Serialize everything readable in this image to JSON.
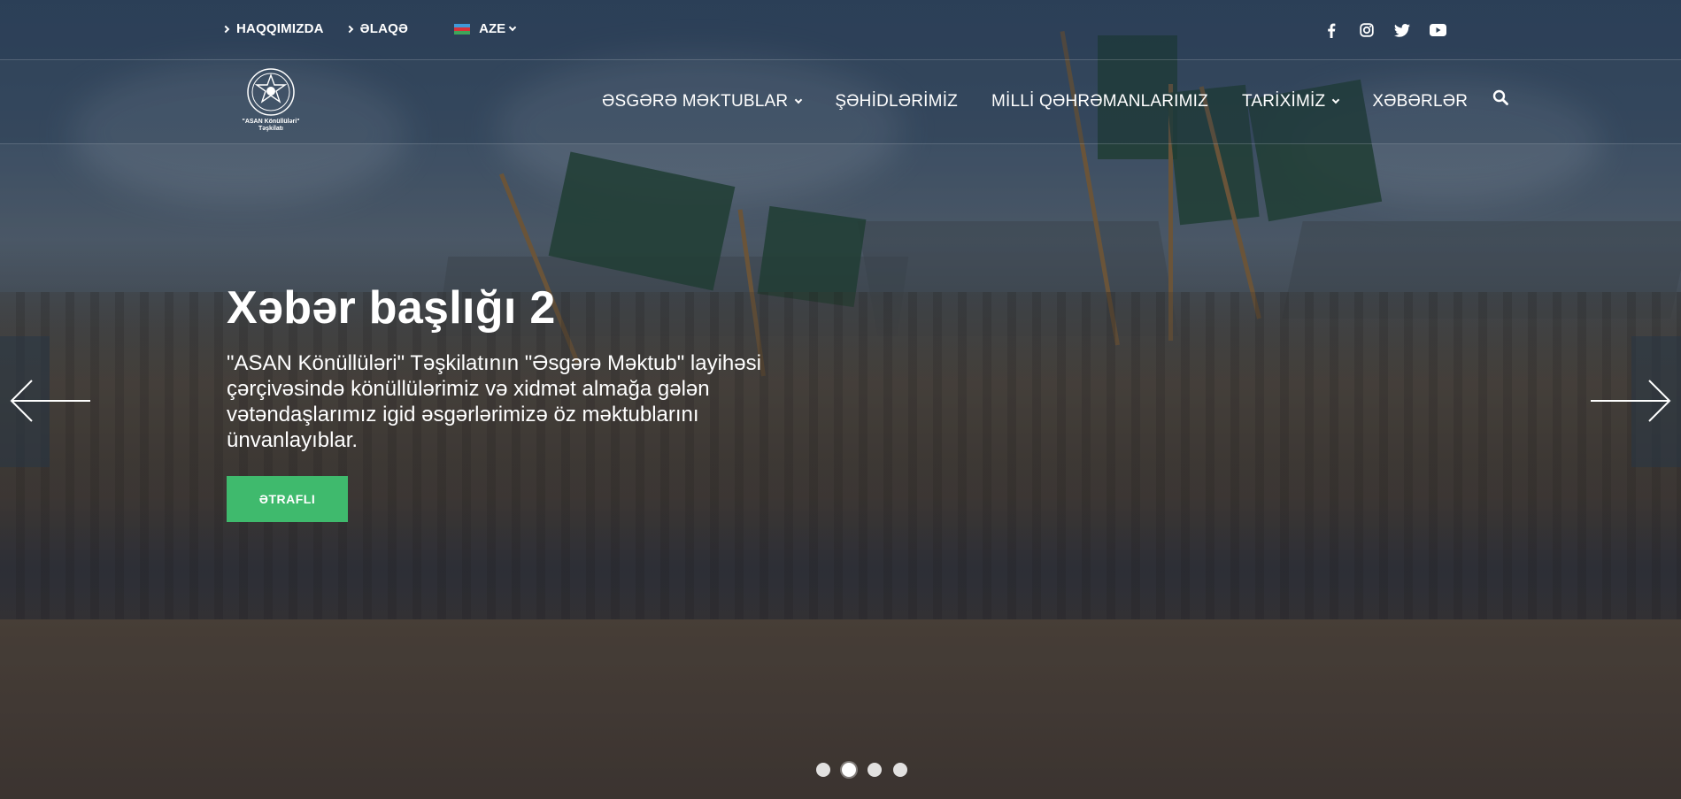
{
  "topbar": {
    "links": [
      {
        "label": "HAQQIMIZDA"
      },
      {
        "label": "ƏLAQƏ"
      }
    ],
    "language": {
      "label": "AZE",
      "flag_icon": "azerbaijan-flag-icon"
    },
    "socials": [
      {
        "icon": "facebook-icon"
      },
      {
        "icon": "instagram-icon"
      },
      {
        "icon": "twitter-icon"
      },
      {
        "icon": "youtube-icon"
      }
    ]
  },
  "logo": {
    "line1": "\"ASAN Könüllüləri\"",
    "line2": "Təşkilatı"
  },
  "nav": {
    "items": [
      {
        "label": "ƏSGƏRƏ MƏKTUBLAR",
        "dropdown": true
      },
      {
        "label": "ŞƏHİDLƏRİMİZ",
        "dropdown": false
      },
      {
        "label": "MİLLİ QƏHRƏMANLARIMIZ",
        "dropdown": false
      },
      {
        "label": "TARİXİMİZ",
        "dropdown": true
      },
      {
        "label": "XƏBƏRLƏR",
        "dropdown": false
      }
    ],
    "search_icon": "search-icon"
  },
  "slide": {
    "title": "Xəbər başlığı 2",
    "description": "\"ASAN Könüllüləri\" Təşkilatının \"Əsgərə Məktub\" layihəsi çərçivəsində könüllülərimiz və xidmət almağa gələn vətəndaşlarımız igid əsgərlərimizə öz məktublarını ünvanlayıblar.",
    "button_label": "ƏTRAFLI"
  },
  "carousel": {
    "slide_count": 4,
    "active_index": 1
  },
  "colors": {
    "button": "#3fba6d",
    "text": "#ffffff"
  }
}
